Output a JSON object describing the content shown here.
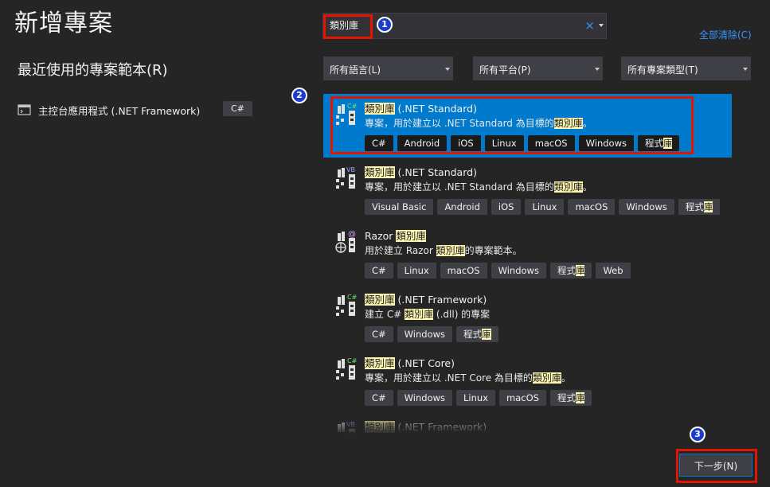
{
  "title": "新增專案",
  "recent": {
    "heading": "最近使用的專案範本(R)",
    "items": [
      {
        "label": "主控台應用程式 (.NET Framework)",
        "lang": "C#"
      }
    ]
  },
  "search": {
    "value": "類別庫",
    "clear_icon": "×"
  },
  "clear_all": "全部清除(C)",
  "filters": {
    "language": "所有語言(L)",
    "platform": "所有平台(P)",
    "project_type": "所有專案類型(T)"
  },
  "templates": [
    {
      "name_hl": "類別庫",
      "name_rest": " (.NET Standard)",
      "desc_pre": "專案，用於建立以 .NET Standard 為目標的",
      "desc_hl": "類別庫",
      "desc_post": "。",
      "icon": "csharp-library-icon",
      "tags": [
        "C#",
        "Android",
        "iOS",
        "Linux",
        "macOS",
        "Windows"
      ],
      "tag_hl": "程式庫",
      "selected": true
    },
    {
      "name_hl": "類別庫",
      "name_rest": " (.NET Standard)",
      "desc_pre": "專案，用於建立以 .NET Standard 為目標的",
      "desc_hl": "類別庫",
      "desc_post": "。",
      "icon": "vb-library-icon",
      "tags": [
        "Visual Basic",
        "Android",
        "iOS",
        "Linux",
        "macOS",
        "Windows"
      ],
      "tag_hl": "程式庫"
    },
    {
      "name_pre": "Razor ",
      "name_hl": "類別庫",
      "name_rest": "",
      "desc_pre": "用於建立 Razor ",
      "desc_hl": "類別庫",
      "desc_post": "的專案範本。",
      "icon": "razor-library-icon",
      "tags": [
        "C#",
        "Linux",
        "macOS",
        "Windows"
      ],
      "tag_hl": "程式庫",
      "tags_after": [
        "Web"
      ]
    },
    {
      "name_hl": "類別庫",
      "name_rest": " (.NET Framework)",
      "desc_pre": "建立 C# ",
      "desc_hl": "類別庫",
      "desc_post": " (.dll) 的專案",
      "icon": "csharp-library-icon",
      "tags": [
        "C#",
        "Windows"
      ],
      "tag_hl": "程式庫"
    },
    {
      "name_hl": "類別庫",
      "name_rest": " (.NET Core)",
      "desc_pre": "專案，用於建立以 .NET Core 為目標的",
      "desc_hl": "類別庫",
      "desc_post": "。",
      "icon": "csharp-library-icon",
      "tags": [
        "C#",
        "Windows",
        "Linux",
        "macOS"
      ],
      "tag_hl": "程式庫"
    },
    {
      "name_hl": "類別庫",
      "name_rest": " (.NET Framework)",
      "desc_pre": "",
      "desc_hl": "",
      "desc_post": "",
      "icon": "vb-library-icon",
      "tags": [],
      "tag_hl": ""
    }
  ],
  "next_button": "下一步(N)",
  "annotations": [
    "1",
    "2",
    "3"
  ],
  "colors": {
    "accent": "#007acc",
    "highlight": "#fff7b1",
    "annotation_red": "#e51400",
    "step_blue": "#1e3ccc"
  }
}
